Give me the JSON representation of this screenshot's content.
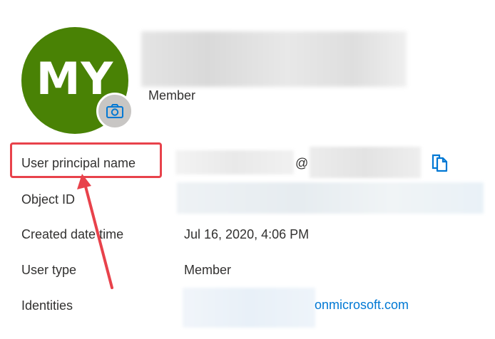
{
  "profile": {
    "initials": "MY",
    "avatar_color": "#498205",
    "subtitle": "Member",
    "camera_icon": "camera-icon"
  },
  "properties": {
    "user_principal_name": {
      "label": "User principal name",
      "separator": "@",
      "copy_icon": "copy-icon"
    },
    "object_id": {
      "label": "Object ID"
    },
    "created_date_time": {
      "label": "Created date time",
      "value": "Jul 16, 2020, 4:06 PM"
    },
    "user_type": {
      "label": "User type",
      "value": "Member"
    },
    "identities": {
      "label": "Identities",
      "value_suffix": "onmicrosoft.com"
    }
  },
  "colors": {
    "highlight": "#e8424b",
    "link": "#0078d4",
    "text": "#323130"
  }
}
